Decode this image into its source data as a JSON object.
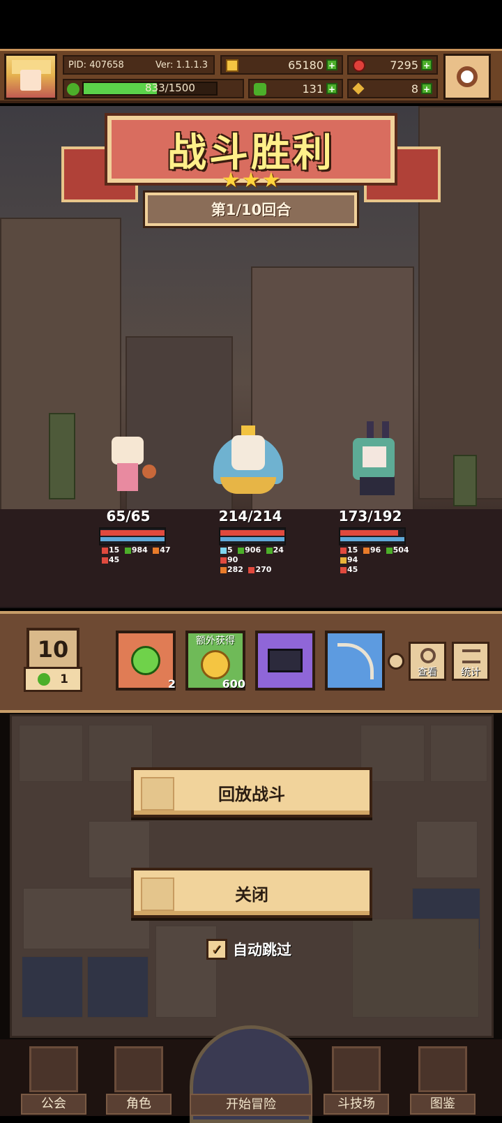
{
  "topbar": {
    "pid": "PID: 407658",
    "version": "Ver: 1.1.1.3",
    "gold": "65180",
    "gems": "7295",
    "exp_text": "833/1500",
    "exp_fraction": 0.555,
    "clover": "131",
    "keys": "8"
  },
  "battle": {
    "title": "战斗胜利",
    "stars": 3,
    "round": "第1/10回合"
  },
  "heroes": [
    {
      "hp": "65/65",
      "hp_fraction": 1.0,
      "stats_line1": [
        "15",
        "984",
        "47",
        "45"
      ],
      "stats_line2": []
    },
    {
      "hp": "214/214",
      "hp_fraction": 1.0,
      "stats_line1": [
        "5",
        "906",
        "24",
        "90"
      ],
      "stats_line2": [
        "282",
        "270"
      ]
    },
    {
      "hp": "173/192",
      "hp_fraction": 0.9,
      "stats_line1": [
        "15",
        "96",
        "504",
        "94"
      ],
      "stats_line2": [
        "45"
      ]
    }
  ],
  "rewards": {
    "level": "10",
    "level_sub": "1",
    "extra_label": "额外获得",
    "items": [
      {
        "name": "clover",
        "count": "2"
      },
      {
        "name": "gold-coin",
        "count": "600"
      },
      {
        "name": "armor",
        "count": ""
      },
      {
        "name": "bow",
        "count": ""
      }
    ],
    "view_label": "查看",
    "stats_label": "统计"
  },
  "actions": {
    "replay": "回放战斗",
    "close": "关闭",
    "autoskip": "自动跳过",
    "autoskip_checked": true
  },
  "nav": {
    "guild": "公会",
    "character": "角色",
    "adventure": "开始冒险",
    "arena": "斗技场",
    "codex": "图鉴"
  }
}
